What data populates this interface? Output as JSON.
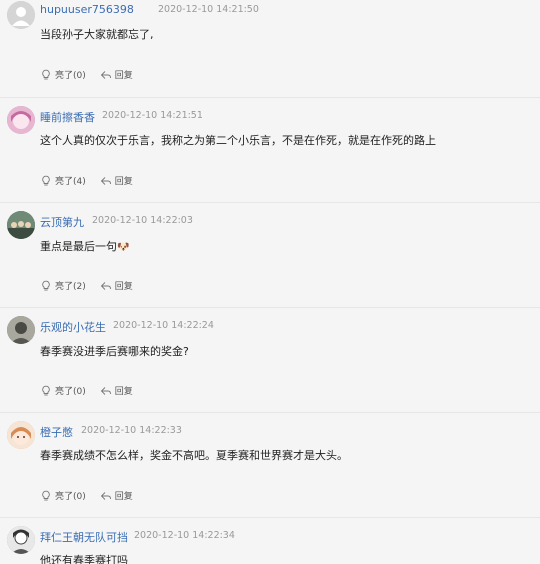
{
  "comments": [
    {
      "username": "hupuuser756398",
      "time": "2020-12-10 14:21:50",
      "content": "当段孙子大家就都忘了,",
      "like_label": "亮了(0)",
      "reply_label": "回复",
      "avatar_color": "#c9c9c9"
    },
    {
      "username": "睡前擦香香",
      "time": "2020-12-10 14:21:51",
      "content": "这个人真的仅次于乐言，我称之为第二个小乐言，不是在作死，就是在作死的路上",
      "like_label": "亮了(4)",
      "reply_label": "回复",
      "avatar_color": "#d98ab4"
    },
    {
      "username": "云顶第九",
      "time": "2020-12-10 14:22:03",
      "content": "重点是最后一句",
      "emoji": "🐶",
      "like_label": "亮了(2)",
      "reply_label": "回复",
      "avatar_color": "#5a6e5a"
    },
    {
      "username": "乐观的小花生",
      "time": "2020-12-10 14:22:24",
      "content": "春季赛没进季后赛哪来的奖金?",
      "like_label": "亮了(0)",
      "reply_label": "回复",
      "avatar_color": "#7a7a72"
    },
    {
      "username": "橙子憋",
      "time": "2020-12-10 14:22:33",
      "content": "春季赛成绩不怎么样，奖金不高吧。夏季赛和世界赛才是大头。",
      "like_label": "亮了(0)",
      "reply_label": "回复",
      "avatar_color": "#e6b090"
    },
    {
      "username": "拜仁王朝无队可挡",
      "time": "2020-12-10 14:22:34",
      "content": "他还有春季赛打吗",
      "like_label": "",
      "reply_label": "",
      "avatar_color": "#9a9a9a"
    }
  ]
}
